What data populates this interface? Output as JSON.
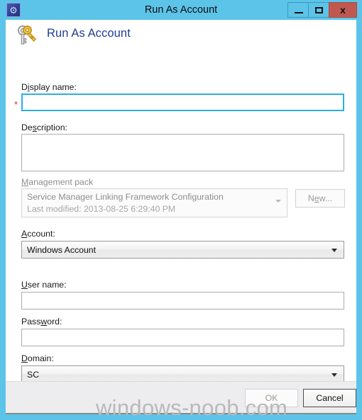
{
  "window": {
    "title": "Run As Account",
    "icon": "app-shield-icon",
    "frame_color": "#5cc4e8",
    "caption_buttons": {
      "minimize": "minimize-icon",
      "maximize": "maximize-icon",
      "close": "x",
      "close_color": "#c0584f"
    }
  },
  "banner": {
    "icon": "keys-icon",
    "title": "Run As Account",
    "title_color": "#1f3f93"
  },
  "form": {
    "display_name": {
      "label_pre": "D",
      "label_accel": "i",
      "label_post": "splay name:",
      "label_full": "Display name:",
      "value": "",
      "required_marker": "*",
      "required_color": "#d03030",
      "focused": true
    },
    "description": {
      "label_pre": "De",
      "label_accel": "s",
      "label_post": "cription:",
      "label_full": "Description:",
      "value": ""
    },
    "management_pack": {
      "label_accel": "M",
      "label_post": "anagement pack",
      "label_full": "Management pack",
      "selected": "Service Manager Linking Framework Configuration",
      "last_modified": "Last modified:  2013-08-25 6:29:40 PM",
      "disabled": true,
      "new_button": {
        "pre": "N",
        "accel": "e",
        "post": "w...",
        "full": "New...",
        "disabled": true
      }
    },
    "account": {
      "label_accel": "A",
      "label_post": "ccount:",
      "label_full": "Account:",
      "value": "Windows Account"
    },
    "user_name": {
      "label_accel": "U",
      "label_post": "ser name:",
      "label_full": "User name:",
      "value": ""
    },
    "password": {
      "label_pre": "Pass",
      "label_accel": "w",
      "label_post": "ord:",
      "label_full": "Password:",
      "value": ""
    },
    "domain": {
      "label_accel": "D",
      "label_post": "omain:",
      "label_full": "Domain:",
      "value": "SC"
    }
  },
  "footer": {
    "ok_label": "OK",
    "ok_disabled": true,
    "cancel_label": "Cancel",
    "cancel_default": true
  },
  "watermark": {
    "text": "windows-noob.com"
  }
}
